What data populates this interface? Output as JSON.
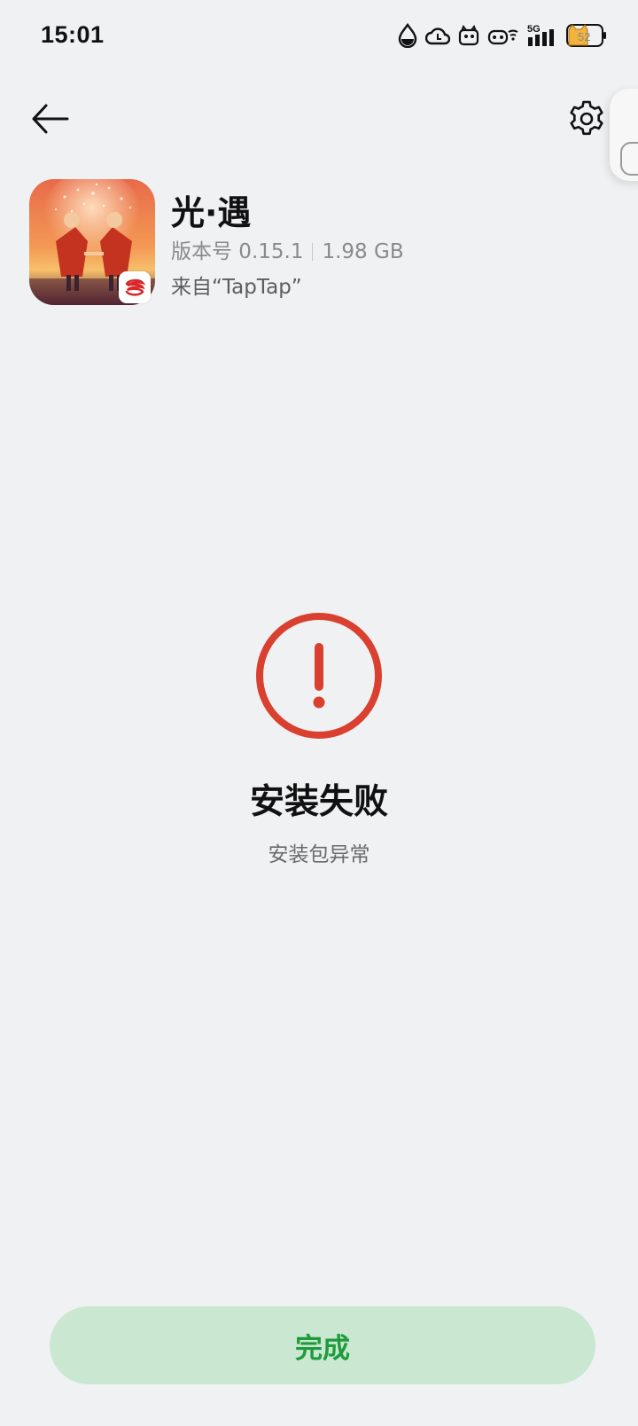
{
  "status_bar": {
    "time": "15:01",
    "network_label": "5G",
    "battery_level": "52",
    "icons": [
      "water-drop-icon",
      "cloud-icon",
      "cat-notification-icon",
      "wifi-icon",
      "signal-icon",
      "battery-icon"
    ]
  },
  "header": {
    "back_icon": "arrow-left-icon",
    "settings_icon": "gear-icon"
  },
  "app": {
    "name": "光·遇",
    "version": "版本号 0.15.1",
    "size": "1.98 GB",
    "source": "来自“TapTap”",
    "badge_icon": "netease-logo-icon"
  },
  "result": {
    "icon": "exclamation-circle-icon",
    "title": "安装失败",
    "reason": "安装包异常",
    "accent_color": "#d9402f"
  },
  "footer": {
    "done_label": "完成",
    "done_bg": "#cae8d1",
    "done_text_color": "#1e9b3a"
  }
}
